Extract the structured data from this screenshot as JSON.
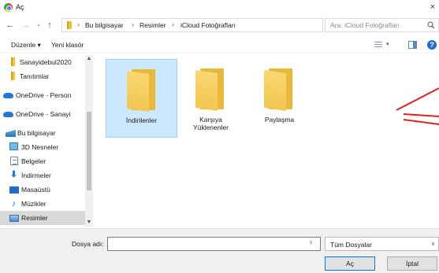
{
  "window": {
    "title": "Aç",
    "close_label": "×"
  },
  "address": {
    "crumbs": [
      "Bu bilgisayar",
      "Resimler",
      "iCloud Fotoğrafları"
    ],
    "separator": "›"
  },
  "search": {
    "placeholder": "Ara: iCloud Fotoğrafları"
  },
  "toolbar": {
    "organize_label": "Düzenle ▾",
    "new_folder_label": "Yeni klasör"
  },
  "sidebar": {
    "items": [
      {
        "label": "Sanayidebul2020",
        "icon": "folder-icon"
      },
      {
        "label": "Tanıtımlar",
        "icon": "folder-icon"
      },
      {
        "label": "OneDrive - Person",
        "icon": "cloud-icon"
      },
      {
        "label": "OneDrive - Sanayi",
        "icon": "cloud-icon"
      },
      {
        "label": "Bu bilgisayar",
        "icon": "computer-icon"
      },
      {
        "label": "3D Nesneler",
        "icon": "3d-objects-icon"
      },
      {
        "label": "Belgeler",
        "icon": "documents-icon"
      },
      {
        "label": "İndirmeler",
        "icon": "downloads-icon"
      },
      {
        "label": "Masaüstü",
        "icon": "desktop-icon"
      },
      {
        "label": "Müzikler",
        "icon": "music-icon"
      },
      {
        "label": "Resimler",
        "icon": "pictures-icon",
        "selected": true
      }
    ]
  },
  "files": [
    {
      "label": "İndirilenler",
      "selected": true
    },
    {
      "label": "Karşıya\nYüklenenler",
      "selected": false
    },
    {
      "label": "Paylaşma",
      "selected": false
    }
  ],
  "footer": {
    "filename_label": "Dosya adı:",
    "filename_value": "",
    "filter_value": "Tüm Dosyalar",
    "open_label": "Aç",
    "cancel_label": "İptal"
  },
  "colors": {
    "accent": "#0078d7",
    "selection": "#cce8ff",
    "annotation": "#e02020",
    "background": "#f8e6c6"
  }
}
